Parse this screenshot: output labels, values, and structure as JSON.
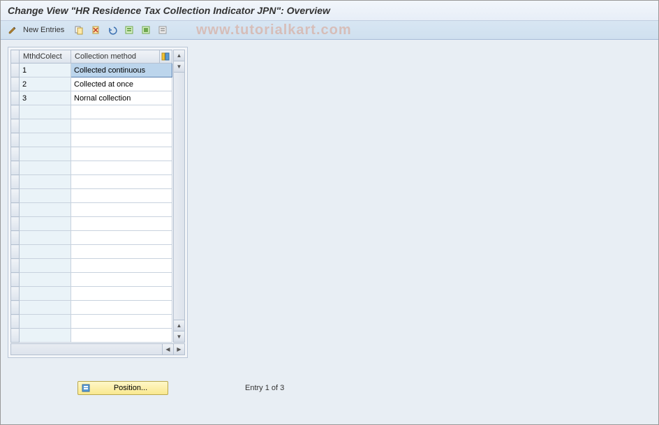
{
  "header": {
    "title": "Change View \"HR Residence Tax Collection Indicator JPN\": Overview"
  },
  "toolbar": {
    "new_entries_label": "New Entries"
  },
  "watermark": "www.tutorialkart.com",
  "grid": {
    "columns": [
      "MthdColect",
      "Collection method"
    ],
    "rows": [
      {
        "code": "1",
        "method": "Collected continuous"
      },
      {
        "code": "2",
        "method": "Collected at once"
      },
      {
        "code": "3",
        "method": "Nornal collection"
      }
    ],
    "empty_rows": 17
  },
  "footer": {
    "position_label": "Position...",
    "entry_text": "Entry 1 of 3"
  }
}
